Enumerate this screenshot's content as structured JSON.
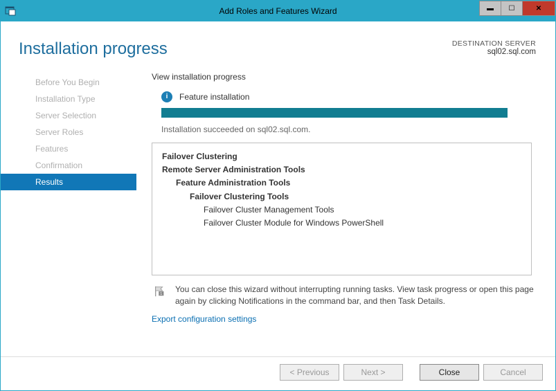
{
  "titlebar": {
    "title": "Add Roles and Features Wizard"
  },
  "header": {
    "title": "Installation progress",
    "destination_label": "DESTINATION SERVER",
    "destination_value": "sql02.sql.com"
  },
  "sidebar": {
    "items": [
      {
        "label": "Before You Begin"
      },
      {
        "label": "Installation Type"
      },
      {
        "label": "Server Selection"
      },
      {
        "label": "Server Roles"
      },
      {
        "label": "Features"
      },
      {
        "label": "Confirmation"
      },
      {
        "label": "Results"
      }
    ]
  },
  "main": {
    "legend": "View installation progress",
    "status_text": "Feature installation",
    "succeeded_text": "Installation succeeded on sql02.sql.com.",
    "features": [
      {
        "text": "Failover Clustering",
        "level": 1,
        "bold": true
      },
      {
        "text": "Remote Server Administration Tools",
        "level": 1,
        "bold": true
      },
      {
        "text": "Feature Administration Tools",
        "level": 2,
        "bold": true
      },
      {
        "text": "Failover Clustering Tools",
        "level": 3,
        "bold": true
      },
      {
        "text": "Failover Cluster Management Tools",
        "level": 4,
        "bold": false
      },
      {
        "text": "Failover Cluster Module for Windows PowerShell",
        "level": 4,
        "bold": false
      }
    ],
    "note_text": "You can close this wizard without interrupting running tasks. View task progress or open this page again by clicking Notifications in the command bar, and then Task Details.",
    "export_link": "Export configuration settings"
  },
  "footer": {
    "previous": "< Previous",
    "next": "Next >",
    "close": "Close",
    "cancel": "Cancel"
  }
}
